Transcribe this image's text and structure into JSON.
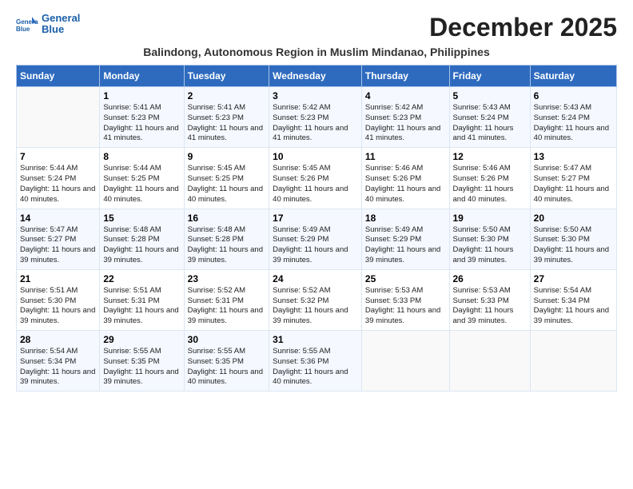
{
  "header": {
    "logo_line1": "General",
    "logo_line2": "Blue",
    "title": "December 2025",
    "subtitle": "Balindong, Autonomous Region in Muslim Mindanao, Philippines"
  },
  "days_of_week": [
    "Sunday",
    "Monday",
    "Tuesday",
    "Wednesday",
    "Thursday",
    "Friday",
    "Saturday"
  ],
  "weeks": [
    [
      {
        "day": "",
        "info": ""
      },
      {
        "day": "1",
        "info": "Sunrise: 5:41 AM\nSunset: 5:23 PM\nDaylight: 11 hours and 41 minutes."
      },
      {
        "day": "2",
        "info": "Sunrise: 5:41 AM\nSunset: 5:23 PM\nDaylight: 11 hours and 41 minutes."
      },
      {
        "day": "3",
        "info": "Sunrise: 5:42 AM\nSunset: 5:23 PM\nDaylight: 11 hours and 41 minutes."
      },
      {
        "day": "4",
        "info": "Sunrise: 5:42 AM\nSunset: 5:23 PM\nDaylight: 11 hours and 41 minutes."
      },
      {
        "day": "5",
        "info": "Sunrise: 5:43 AM\nSunset: 5:24 PM\nDaylight: 11 hours and 41 minutes."
      },
      {
        "day": "6",
        "info": "Sunrise: 5:43 AM\nSunset: 5:24 PM\nDaylight: 11 hours and 40 minutes."
      }
    ],
    [
      {
        "day": "7",
        "info": "Sunrise: 5:44 AM\nSunset: 5:24 PM\nDaylight: 11 hours and 40 minutes."
      },
      {
        "day": "8",
        "info": "Sunrise: 5:44 AM\nSunset: 5:25 PM\nDaylight: 11 hours and 40 minutes."
      },
      {
        "day": "9",
        "info": "Sunrise: 5:45 AM\nSunset: 5:25 PM\nDaylight: 11 hours and 40 minutes."
      },
      {
        "day": "10",
        "info": "Sunrise: 5:45 AM\nSunset: 5:26 PM\nDaylight: 11 hours and 40 minutes."
      },
      {
        "day": "11",
        "info": "Sunrise: 5:46 AM\nSunset: 5:26 PM\nDaylight: 11 hours and 40 minutes."
      },
      {
        "day": "12",
        "info": "Sunrise: 5:46 AM\nSunset: 5:26 PM\nDaylight: 11 hours and 40 minutes."
      },
      {
        "day": "13",
        "info": "Sunrise: 5:47 AM\nSunset: 5:27 PM\nDaylight: 11 hours and 40 minutes."
      }
    ],
    [
      {
        "day": "14",
        "info": "Sunrise: 5:47 AM\nSunset: 5:27 PM\nDaylight: 11 hours and 39 minutes."
      },
      {
        "day": "15",
        "info": "Sunrise: 5:48 AM\nSunset: 5:28 PM\nDaylight: 11 hours and 39 minutes."
      },
      {
        "day": "16",
        "info": "Sunrise: 5:48 AM\nSunset: 5:28 PM\nDaylight: 11 hours and 39 minutes."
      },
      {
        "day": "17",
        "info": "Sunrise: 5:49 AM\nSunset: 5:29 PM\nDaylight: 11 hours and 39 minutes."
      },
      {
        "day": "18",
        "info": "Sunrise: 5:49 AM\nSunset: 5:29 PM\nDaylight: 11 hours and 39 minutes."
      },
      {
        "day": "19",
        "info": "Sunrise: 5:50 AM\nSunset: 5:30 PM\nDaylight: 11 hours and 39 minutes."
      },
      {
        "day": "20",
        "info": "Sunrise: 5:50 AM\nSunset: 5:30 PM\nDaylight: 11 hours and 39 minutes."
      }
    ],
    [
      {
        "day": "21",
        "info": "Sunrise: 5:51 AM\nSunset: 5:30 PM\nDaylight: 11 hours and 39 minutes."
      },
      {
        "day": "22",
        "info": "Sunrise: 5:51 AM\nSunset: 5:31 PM\nDaylight: 11 hours and 39 minutes."
      },
      {
        "day": "23",
        "info": "Sunrise: 5:52 AM\nSunset: 5:31 PM\nDaylight: 11 hours and 39 minutes."
      },
      {
        "day": "24",
        "info": "Sunrise: 5:52 AM\nSunset: 5:32 PM\nDaylight: 11 hours and 39 minutes."
      },
      {
        "day": "25",
        "info": "Sunrise: 5:53 AM\nSunset: 5:33 PM\nDaylight: 11 hours and 39 minutes."
      },
      {
        "day": "26",
        "info": "Sunrise: 5:53 AM\nSunset: 5:33 PM\nDaylight: 11 hours and 39 minutes."
      },
      {
        "day": "27",
        "info": "Sunrise: 5:54 AM\nSunset: 5:34 PM\nDaylight: 11 hours and 39 minutes."
      }
    ],
    [
      {
        "day": "28",
        "info": "Sunrise: 5:54 AM\nSunset: 5:34 PM\nDaylight: 11 hours and 39 minutes."
      },
      {
        "day": "29",
        "info": "Sunrise: 5:55 AM\nSunset: 5:35 PM\nDaylight: 11 hours and 39 minutes."
      },
      {
        "day": "30",
        "info": "Sunrise: 5:55 AM\nSunset: 5:35 PM\nDaylight: 11 hours and 40 minutes."
      },
      {
        "day": "31",
        "info": "Sunrise: 5:55 AM\nSunset: 5:36 PM\nDaylight: 11 hours and 40 minutes."
      },
      {
        "day": "",
        "info": ""
      },
      {
        "day": "",
        "info": ""
      },
      {
        "day": "",
        "info": ""
      }
    ]
  ]
}
